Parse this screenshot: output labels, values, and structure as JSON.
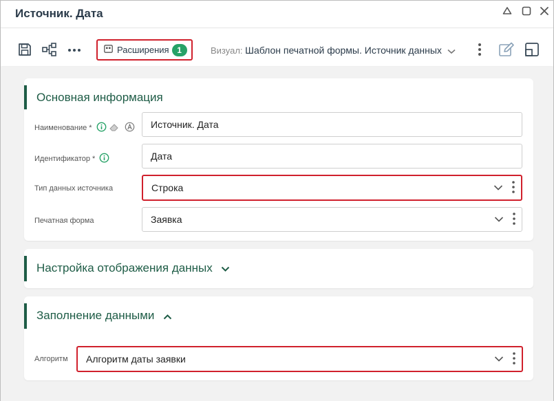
{
  "window": {
    "title": "Источник. Дата",
    "controls": [
      "collapse-icon",
      "maximize-icon",
      "close-icon"
    ]
  },
  "toolbar": {
    "icons": [
      "save-icon",
      "share-icon",
      "more-icon"
    ],
    "extensions_label": "Расширения",
    "extensions_count": "1",
    "visual_label": "Визуал:",
    "visual_value": "Шаблон печатной формы. Источник данных",
    "right_icons": [
      "edit-icon",
      "layout-icon"
    ]
  },
  "sections": {
    "basic": {
      "title": "Основная информация",
      "name_label": "Наименование *",
      "name_value": "Источник. Дата",
      "id_label": "Идентификатор *",
      "id_value": "Дата",
      "type_label": "Тип данных источника",
      "type_value": "Строка",
      "form_label": "Печатная форма",
      "form_value": "Заявка"
    },
    "display": {
      "title": "Настройка отображения данных",
      "expanded": false
    },
    "fill": {
      "title": "Заполнение данными",
      "expanded": true,
      "algorithm_label": "Алгоритм",
      "algorithm_value": "Алгоритм даты заявки"
    }
  },
  "colors": {
    "accent_green": "#1e5c46",
    "badge_green": "#26a267",
    "highlight_red": "#d0202c"
  }
}
